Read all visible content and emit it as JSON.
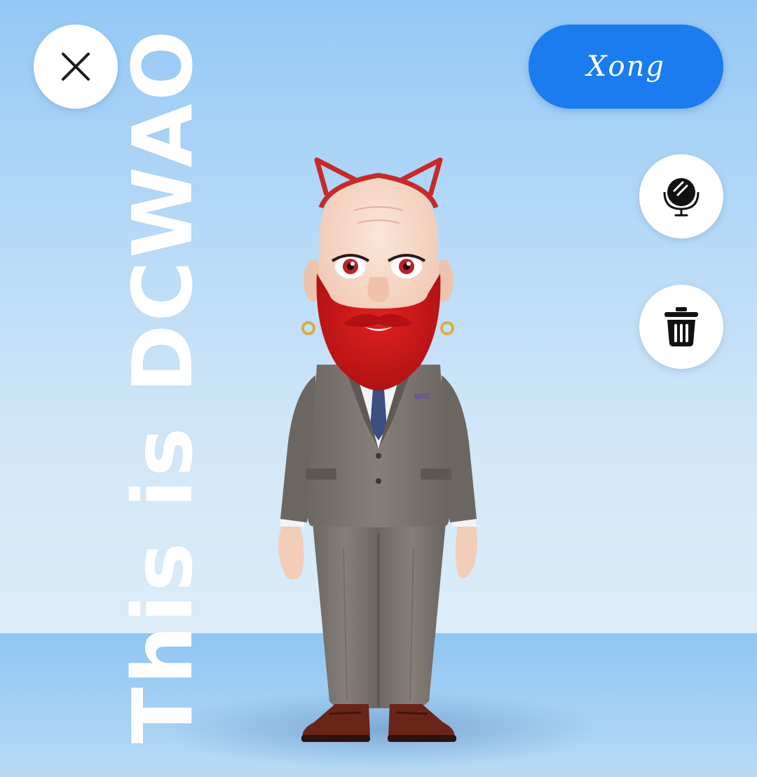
{
  "toolbar": {
    "close_icon": "close-icon",
    "done_label": "Xong",
    "mirror_icon": "mirror-icon",
    "delete_icon": "trash-icon"
  },
  "watermark": {
    "text": "This is DCWAO"
  },
  "avatar": {
    "description_icon": "avatar-figure",
    "colors": {
      "beard": "#c8161a",
      "ears": "#c62a2a",
      "suit": "#7a7470",
      "tie": "#3b4f80",
      "shoes": "#6a2418",
      "skin": "#f4d2bd"
    }
  },
  "theme": {
    "accent": "#1b7cf0",
    "background": "#b3d8f7"
  }
}
